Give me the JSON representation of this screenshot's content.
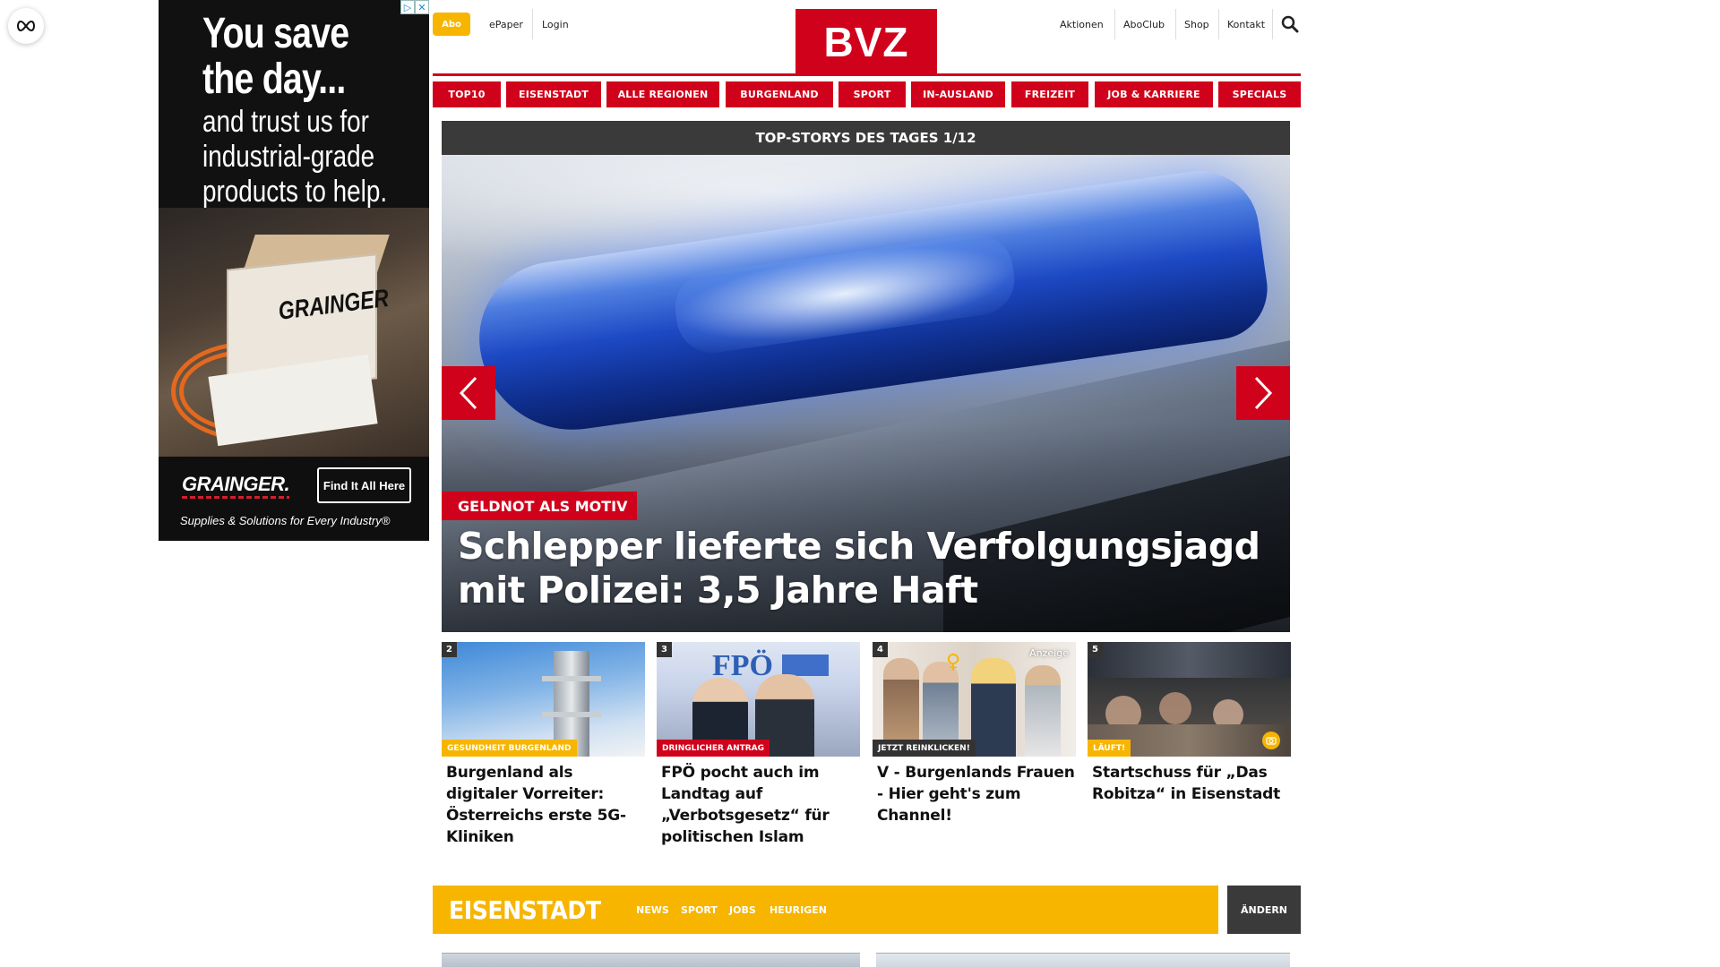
{
  "float_button": {
    "icon": "infinity-link-icon"
  },
  "ad": {
    "headline_line1": "You save",
    "headline_line2": "the day...",
    "sub_line1": "and trust us for",
    "sub_line2": "industrial-grade",
    "sub_line3": "products to help.",
    "box_brand": "GRAINGER",
    "brand": "GRAINGER.",
    "cta": "Find It All Here",
    "slogan": "Supplies & Solutions for Every Industry®",
    "choices_icon_1": "▷",
    "choices_icon_2": "✕"
  },
  "header": {
    "abo": "Abo",
    "epaper": "ePaper",
    "login": "Login",
    "logo": "BVZ",
    "right_links": [
      "Aktionen",
      "AboClub",
      "Shop",
      "Kontakt"
    ],
    "search_icon": "search-icon",
    "brand_color": "#d0021b",
    "accent_color": "#f7b500"
  },
  "nav": {
    "items": [
      "TOP10",
      "EISENSTADT",
      "ALLE REGIONEN",
      "BURGENLAND",
      "SPORT",
      "IN-AUSLAND",
      "FREIZEIT",
      "JOB & KARRIERE",
      "SPECIALS"
    ]
  },
  "carousel": {
    "title": "TOP-STORYS DES TAGES 1/12",
    "kicker": "GELDNOT ALS MOTIV",
    "headline": "Schlepper lieferte sich Verfolgungsjagd mit Polizei: 3,5 Jahre Haft",
    "prev_icon": "chevron-left-icon",
    "next_icon": "chevron-right-icon"
  },
  "teasers": [
    {
      "num": "2",
      "kicker": "GESUNDHEIT BURGENLAND",
      "kicker_color": "#f7b500",
      "title": "Burgenland als digitaler Vorreiter: Österreichs erste 5G-Kliniken"
    },
    {
      "num": "3",
      "kicker": "DRINGLICHER ANTRAG",
      "kicker_color": "#d0021b",
      "title": "FPÖ pocht auch im Landtag auf „Verbotsgesetz“ für politischen Islam",
      "image_text": "FPÖ"
    },
    {
      "num": "4",
      "kicker": "JETZT REINKLICKEN!",
      "kicker_color": "#333333",
      "title": "V - Burgenlands Frauen - Hier geht's zum Channel!",
      "anzeige": "Anzeige"
    },
    {
      "num": "5",
      "kicker": "LÄUFT!",
      "kicker_color": "#f7b500",
      "title": "Startschuss für „Das Robitza“ in Eisenstadt"
    }
  ],
  "region": {
    "name": "EISENSTADT",
    "links": [
      "NEWS",
      "SPORT",
      "JOBS",
      "HEURIGEN"
    ],
    "change": "ÄNDERN"
  }
}
